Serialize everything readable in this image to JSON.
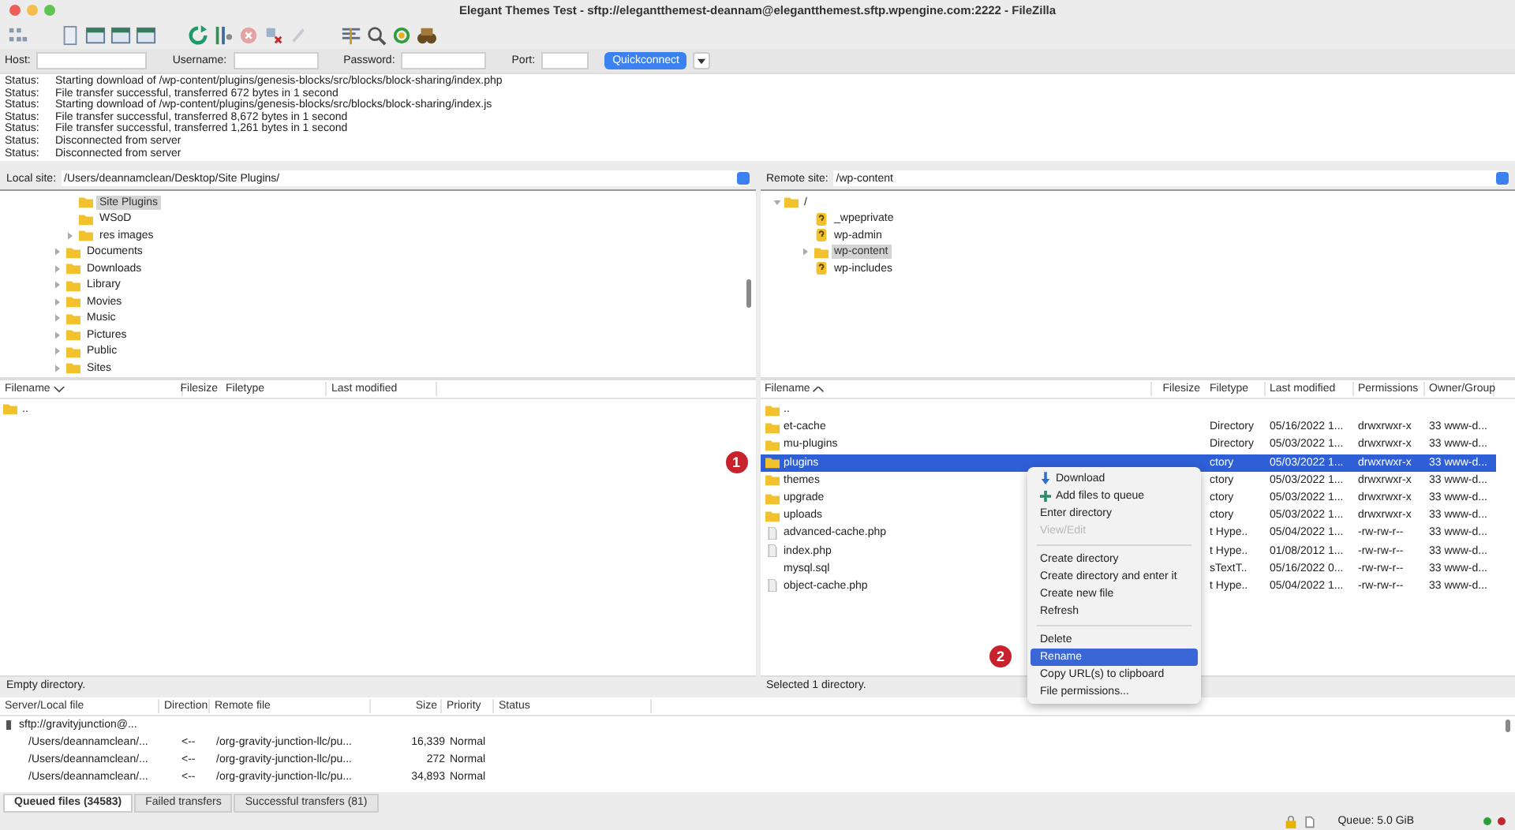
{
  "window": {
    "title": "Elegant Themes Test - sftp://elegantthemest-deannam@elegantthemest.sftp.wpengine.com:2222 - FileZilla"
  },
  "quickconnect": {
    "host_label": "Host:",
    "username_label": "Username:",
    "password_label": "Password:",
    "port_label": "Port:",
    "button": "Quickconnect"
  },
  "log": [
    {
      "label": "Status:",
      "message": "Starting download of /wp-content/plugins/genesis-blocks/src/blocks/block-sharing/index.php"
    },
    {
      "label": "Status:",
      "message": "File transfer successful, transferred 672 bytes in 1 second"
    },
    {
      "label": "Status:",
      "message": "Starting download of /wp-content/plugins/genesis-blocks/src/blocks/block-sharing/index.js"
    },
    {
      "label": "Status:",
      "message": "File transfer successful, transferred 8,672 bytes in 1 second"
    },
    {
      "label": "Status:",
      "message": "File transfer successful, transferred 1,261 bytes in 1 second"
    },
    {
      "label": "Status:",
      "message": "Disconnected from server"
    },
    {
      "label": "Status:",
      "message": "Disconnected from server"
    }
  ],
  "local": {
    "site_label": "Local site:",
    "path": "/Users/deannamclean/Desktop/Site Plugins/",
    "tree_nested": [
      {
        "label": "Site Plugins",
        "selected": true,
        "expandable": false
      },
      {
        "label": "WSoD",
        "selected": false,
        "expandable": false
      },
      {
        "label": "res images",
        "selected": false,
        "expandable": true
      }
    ],
    "tree": [
      {
        "label": "Documents",
        "selected": false,
        "expandable": true
      },
      {
        "label": "Downloads",
        "selected": false,
        "expandable": true
      },
      {
        "label": "Library",
        "selected": false,
        "expandable": true
      },
      {
        "label": "Movies",
        "selected": false,
        "expandable": true
      },
      {
        "label": "Music",
        "selected": false,
        "expandable": true
      },
      {
        "label": "Pictures",
        "selected": false,
        "expandable": true
      },
      {
        "label": "Public",
        "selected": false,
        "expandable": true
      },
      {
        "label": "Sites",
        "selected": false,
        "expandable": true
      }
    ],
    "columns": [
      "Filename",
      "Filesize",
      "Filetype",
      "Last modified"
    ],
    "rows": [
      {
        "name": ".."
      }
    ],
    "status": "Empty directory."
  },
  "remote": {
    "site_label": "Remote site:",
    "path": "/wp-content",
    "tree": [
      {
        "label": "/",
        "kind": "folder",
        "expanded": true,
        "selected": false,
        "children": [
          {
            "label": "_wpeprivate",
            "kind": "unknown",
            "selected": false,
            "expandable": false
          },
          {
            "label": "wp-admin",
            "kind": "unknown",
            "selected": false,
            "expandable": false
          },
          {
            "label": "wp-content",
            "kind": "folder",
            "selected": true,
            "expandable": true
          },
          {
            "label": "wp-includes",
            "kind": "unknown",
            "selected": false,
            "expandable": false
          }
        ]
      }
    ],
    "columns": [
      "Filename",
      "Filesize",
      "Filetype",
      "Last modified",
      "Permissions",
      "Owner/Group"
    ],
    "rows": [
      {
        "name": "..",
        "kind": "folder",
        "selected": false
      },
      {
        "name": "et-cache",
        "kind": "folder",
        "selected": false,
        "type": "Directory",
        "modified": "05/16/2022 1...",
        "permissions": "drwxrwxr-x",
        "owner": "33 www-d..."
      },
      {
        "name": "mu-plugins",
        "kind": "folder",
        "selected": false,
        "type": "Directory",
        "modified": "05/03/2022 1...",
        "permissions": "drwxrwxr-x",
        "owner": "33 www-d..."
      },
      {
        "name": "plugins",
        "kind": "folder",
        "selected": true,
        "type": "ctory",
        "modified": "05/03/2022 1...",
        "permissions": "drwxrwxr-x",
        "owner": "33 www-d..."
      },
      {
        "name": "themes",
        "kind": "folder",
        "selected": false,
        "type": "ctory",
        "modified": "05/03/2022 1...",
        "permissions": "drwxrwxr-x",
        "owner": "33 www-d..."
      },
      {
        "name": "upgrade",
        "kind": "folder",
        "selected": false,
        "type": "ctory",
        "modified": "05/03/2022 1...",
        "permissions": "drwxrwxr-x",
        "owner": "33 www-d..."
      },
      {
        "name": "uploads",
        "kind": "folder",
        "selected": false,
        "type": "ctory",
        "modified": "05/03/2022 1...",
        "permissions": "drwxrwxr-x",
        "owner": "33 www-d..."
      },
      {
        "name": "advanced-cache.php",
        "kind": "file",
        "selected": false,
        "type": "t Hype..",
        "modified": "05/04/2022 1...",
        "permissions": "-rw-rw-r--",
        "owner": "33 www-d..."
      },
      {
        "name": "index.php",
        "kind": "file",
        "selected": false,
        "type": "t Hype..",
        "modified": "01/08/2012 1...",
        "permissions": "-rw-rw-r--",
        "owner": "33 www-d..."
      },
      {
        "name": "mysql.sql",
        "kind": "blank",
        "selected": false,
        "type": "sTextT..",
        "modified": "05/16/2022 0...",
        "permissions": "-rw-rw-r--",
        "owner": "33 www-d..."
      },
      {
        "name": "object-cache.php",
        "kind": "file",
        "selected": false,
        "type": "t Hype..",
        "modified": "05/04/2022 1...",
        "permissions": "-rw-rw-r--",
        "owner": "33 www-d..."
      }
    ],
    "status": "Selected 1 directory."
  },
  "context_menu": [
    {
      "kind": "download",
      "label": "Download",
      "disabled": false,
      "selected": false
    },
    {
      "kind": "queue",
      "label": "Add files to queue",
      "disabled": false,
      "selected": false
    },
    {
      "kind": "plain",
      "label": "Enter directory",
      "disabled": false,
      "selected": false
    },
    {
      "kind": "plain",
      "label": "View/Edit",
      "disabled": true,
      "selected": false
    },
    {
      "kind": "separator"
    },
    {
      "kind": "plain",
      "label": "Create directory",
      "disabled": false,
      "selected": false
    },
    {
      "kind": "plain",
      "label": "Create directory and enter it",
      "disabled": false,
      "selected": false
    },
    {
      "kind": "plain",
      "label": "Create new file",
      "disabled": false,
      "selected": false
    },
    {
      "kind": "plain",
      "label": "Refresh",
      "disabled": false,
      "selected": false
    },
    {
      "kind": "separator"
    },
    {
      "kind": "plain",
      "label": "Delete",
      "disabled": false,
      "selected": false
    },
    {
      "kind": "plain",
      "label": "Rename",
      "disabled": false,
      "selected": true
    },
    {
      "kind": "plain",
      "label": "Copy URL(s) to clipboard",
      "disabled": false,
      "selected": false
    },
    {
      "kind": "plain",
      "label": "File permissions...",
      "disabled": false,
      "selected": false
    }
  ],
  "annotations": [
    "1",
    "2"
  ],
  "queue": {
    "columns": [
      "Server/Local file",
      "Direction",
      "Remote file",
      "Size",
      "Priority",
      "Status"
    ],
    "server": "sftp://gravityjunction@...",
    "rows": [
      {
        "local": "/Users/deannamclean/...",
        "direction": "<--",
        "remote": "/org-gravity-junction-llc/pu...",
        "size": "16,339",
        "priority": "Normal"
      },
      {
        "local": "/Users/deannamclean/...",
        "direction": "<--",
        "remote": "/org-gravity-junction-llc/pu...",
        "size": "272",
        "priority": "Normal"
      },
      {
        "local": "/Users/deannamclean/...",
        "direction": "<--",
        "remote": "/org-gravity-junction-llc/pu...",
        "size": "34,893",
        "priority": "Normal"
      }
    ]
  },
  "queue_tabs": [
    {
      "label": "Queued files (34583)",
      "selected": true
    },
    {
      "label": "Failed transfers",
      "selected": false
    },
    {
      "label": "Successful transfers (81)",
      "selected": false
    }
  ],
  "status_bar": {
    "queue": "Queue: 5.0 GiB",
    "indicators": [
      {
        "color": "#2e9e3a"
      },
      {
        "color": "#c0282d"
      }
    ]
  }
}
